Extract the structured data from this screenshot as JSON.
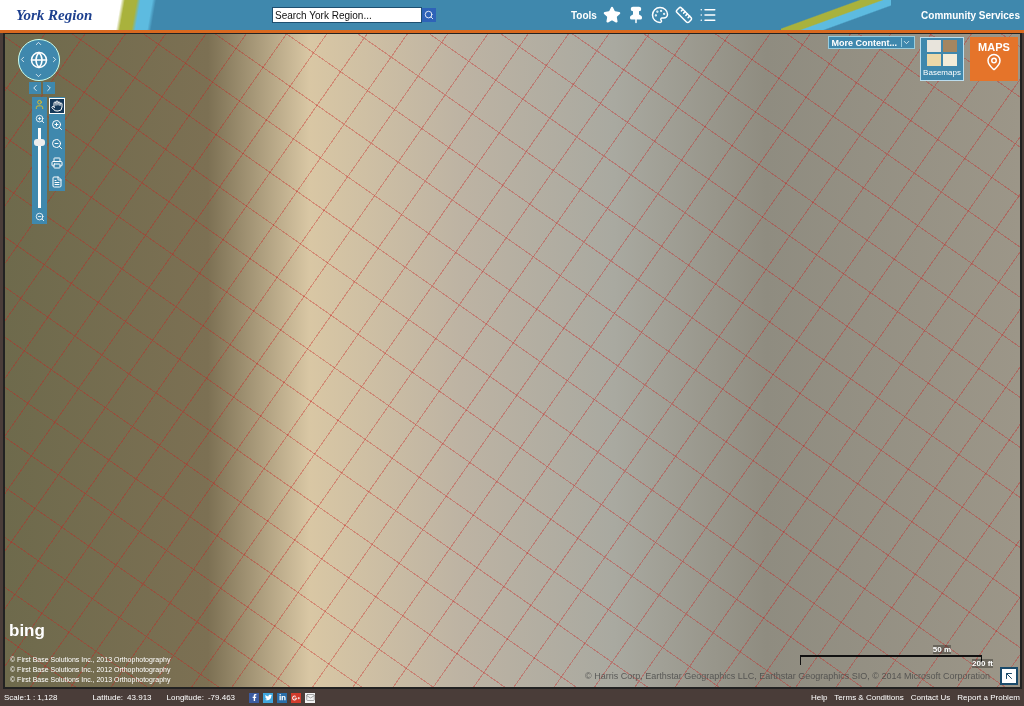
{
  "header": {
    "logo": "York Region",
    "search": {
      "placeholder": "Search York Region..."
    },
    "tools_label": "Tools",
    "link": "Community Services"
  },
  "map": {
    "nav_tools": [
      {
        "kind": "pan",
        "selected": true
      },
      {
        "kind": "zoom-in",
        "selected": false
      },
      {
        "kind": "zoom-out",
        "selected": false
      },
      {
        "kind": "print",
        "selected": false
      },
      {
        "kind": "pdf",
        "selected": false
      }
    ],
    "zoom_slider": {
      "level": 0.85
    },
    "more_content": "More Content...",
    "basemaps": "Basemaps",
    "maps_button": "MAPS",
    "bing": "bing",
    "credits": [
      "© First Base Solutions Inc., 2013 Orthophotography",
      "© First Base Solutions Inc., 2012 Orthophotography",
      "© First Base Solutions Inc., 2013 Orthophotography"
    ],
    "imagery_credit": "© Harris Corp, Earthstar Geographics LLC, Earthstar Geographics SIO, © 2014 Microsoft Corporation",
    "scale_bar": {
      "metric": "50 m",
      "imperial": "200 ft"
    }
  },
  "status_bar": {
    "scale": "Scale:1 : 1,128",
    "latitude_label": "Latitude:",
    "latitude": "43.913",
    "longitude_label": "Longitude:",
    "longitude": "-79.463",
    "links": [
      "Help",
      "Terms & Conditions",
      "Contact Us",
      "Report a Problem"
    ]
  }
}
